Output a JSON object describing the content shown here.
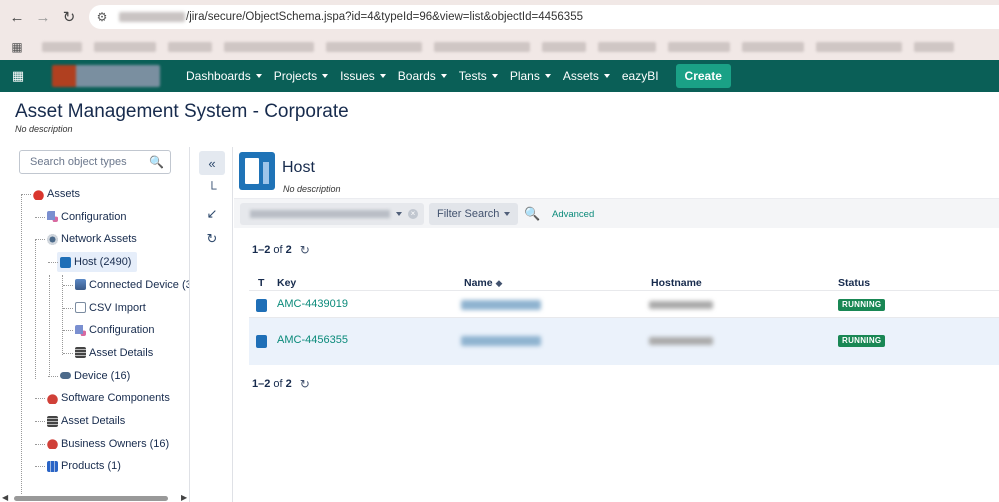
{
  "browser": {
    "url": "/jira/secure/ObjectSchema.jspa?id=4&typeId=96&view=list&objectId=4456355"
  },
  "nav": {
    "items": [
      {
        "label": "Dashboards",
        "has_caret": true
      },
      {
        "label": "Projects",
        "has_caret": true
      },
      {
        "label": "Issues",
        "has_caret": true
      },
      {
        "label": "Boards",
        "has_caret": true
      },
      {
        "label": "Tests",
        "has_caret": true
      },
      {
        "label": "Plans",
        "has_caret": true
      },
      {
        "label": "Assets",
        "has_caret": true
      },
      {
        "label": "eazyBI",
        "has_caret": false
      }
    ],
    "create_label": "Create",
    "bar_color": "#0a5f57",
    "create_color": "#1aa186"
  },
  "page": {
    "title": "Asset Management System - Corporate",
    "subtitle": "No description"
  },
  "tree": {
    "search_placeholder": "Search object types",
    "nodes": [
      {
        "label": "Assets",
        "icon": "assets-icon",
        "level": 0
      },
      {
        "label": "Configuration",
        "icon": "config-icon",
        "level": 1
      },
      {
        "label": "Network Assets",
        "icon": "network-icon",
        "level": 1
      },
      {
        "label": "Host (2490)",
        "icon": "host-icon",
        "level": 2,
        "selected": true
      },
      {
        "label": "Connected Device (37",
        "icon": "device-icon",
        "level": 3
      },
      {
        "label": "CSV Import",
        "icon": "csv-icon",
        "level": 3
      },
      {
        "label": "Configuration",
        "icon": "config-icon",
        "level": 3
      },
      {
        "label": "Asset Details",
        "icon": "asset-details-icon",
        "level": 3
      },
      {
        "label": "Device (16)",
        "icon": "device-icon",
        "level": 2
      },
      {
        "label": "Software Components",
        "icon": "software-icon",
        "level": 1
      },
      {
        "label": "Asset Details",
        "icon": "asset-details-icon",
        "level": 1
      },
      {
        "label": "Business Owners (16)",
        "icon": "owners-icon",
        "level": 1
      },
      {
        "label": "Products (1)",
        "icon": "products-icon",
        "level": 1
      }
    ]
  },
  "object_type": {
    "name": "Host",
    "description": "No description"
  },
  "filter": {
    "filter_search_label": "Filter Search",
    "advanced_label": "Advanced"
  },
  "pagination": {
    "range": "1–2",
    "of_label": "of",
    "total": "2"
  },
  "table": {
    "columns": [
      "T",
      "Key",
      "Name",
      "Hostname",
      "Status"
    ],
    "rows": [
      {
        "key": "AMC-4439019",
        "status": "RUNNING"
      },
      {
        "key": "AMC-4456355",
        "status": "RUNNING"
      }
    ],
    "status_color": "#198754"
  }
}
